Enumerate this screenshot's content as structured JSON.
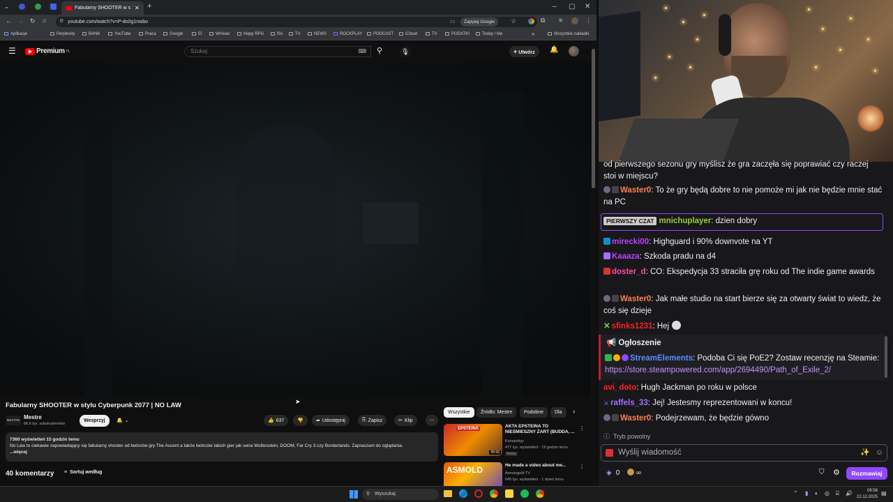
{
  "browser": {
    "tab_title": "Fabularny SHOOTER w stylu",
    "url": "youtube.com/watch?v=P-do0g1nwbo",
    "omnibox_action": "Zapytaj Google",
    "bookmarks": [
      "Aplikacje",
      "Perplexity",
      "BANK",
      "YouTube",
      "Praca",
      "Google",
      "EI",
      "WHead",
      "Mapy RPG",
      "RA",
      "TV",
      "NEWS",
      "ROCKPLAY",
      "PODCAST",
      "iCloud",
      "TV",
      "PODATKI",
      "Today / Me"
    ],
    "all_bookmarks": "Wszystkie zakładki"
  },
  "youtube": {
    "logo_text": "Premium",
    "logo_sup": "PL",
    "search_placeholder": "Szukaj",
    "create_label": "Utwórz",
    "video": {
      "title": "Fabularny SHOOTER w stylu Cyberpunk 2077 | NO LAW",
      "channel": "Mestre",
      "channel_logo_text": "MESTRE",
      "subscribers": "86,6 tys. subskrybentów",
      "join_label": "Wesprzyj",
      "likes": "637",
      "share_label": "Udostępnij",
      "save_label": "Zapisz",
      "clip_label": "Klip",
      "views_time": "7360 wyświetleń  15 godzin temu",
      "description": "No Law to ciekawie zapowiadający się fabularny shooter od twórców gry The Ascent a także twórców takich gier jak seria Wolfenstein, DOOM, Far Cry 3 czy Borderlands. Zapraszam do oglądania.",
      "more_label": "...więcej",
      "comments_count": "40 komentarzy",
      "sort_label": "Sortuj według"
    },
    "chips": [
      "Wszystkie",
      "Źródło: Mestre",
      "Podobne",
      "Dla"
    ],
    "recommendations": [
      {
        "title": "AKTA EPSTEINA TO NIEŚMIESZNY ŻART (BUDDA, ...",
        "channel": "Konopskyy",
        "meta": "477 tys. wyświetleń · 19 godzin temu",
        "badge": "Nowy",
        "duration": "45:56",
        "thumb_text": "EPSTEINA"
      },
      {
        "title": "He made a video about me...",
        "channel": "Asmongold TV",
        "meta": "645 tys. wyświetleń · 1 dzień temu",
        "thumb_text": "ASMOLD"
      }
    ]
  },
  "chat": {
    "messages": [
      {
        "user": "",
        "text": "od pierwszego sezonu gry myślisz że gra zaczęła się poprawiać czy raczej stoi w miejscu?",
        "color": "#efeff1"
      },
      {
        "user": "Waster0",
        "text": ": To że gry będą dobre to nie pomoże mi jak nie będzie mnie stać na PC",
        "color": "#ff7f50"
      },
      {
        "user": "mnichuplayer",
        "text": ": dzien dobry",
        "color": "#9acd32",
        "first_chat": "PIERWSZY CZAT"
      },
      {
        "user": "mirecki00",
        "text": ": Highguard i 90% downvote na YT",
        "color": "#c040ff"
      },
      {
        "user": "Kaaaza",
        "text": ": Szkoda pradu na d4",
        "color": "#c040ff"
      },
      {
        "user": "doster_d",
        "text": ": CO: Ekspedycja 33 straciła grę roku od The indie game awards",
        "color": "#ff4aa0"
      },
      {
        "user": "Waster0",
        "text": ": Jak małe studio na start bierze się za otwarty świat to wiedz, że coś się dzieje",
        "color": "#ff7f50"
      },
      {
        "user": "sfinks1231",
        "text": ": Hej",
        "color": "#ff2020"
      },
      {
        "user": "StreamElements",
        "text": ": Podoba Ci się PoE2? Zostaw recenzję na Steamie:",
        "color": "#5b8cff",
        "link": "https://store.steampowered.com/app/2694490/Path_of_Exile_2/"
      },
      {
        "user": "avi_doto",
        "text": ": Hugh Jackman po roku w polsce",
        "color": "#ff2020"
      },
      {
        "user": "raffels_33",
        "text": ": Jej! Jestesmy reprezentowani w koncu!",
        "color": "#a070ff"
      },
      {
        "user": "Waster0",
        "text": ": Podejrzewam, że będzie gówno",
        "color": "#ff7f50"
      }
    ],
    "announcement_label": "Ogłoszenie",
    "slow_mode": "Tryb powolny",
    "input_placeholder": "Wyślij wiadomość",
    "points": "0",
    "points_suffix": "∞",
    "send_label": "Rozmawiaj"
  },
  "taskbar": {
    "search_placeholder": "Wyszukaj",
    "time": "08:56",
    "date": "22.12.2025"
  }
}
